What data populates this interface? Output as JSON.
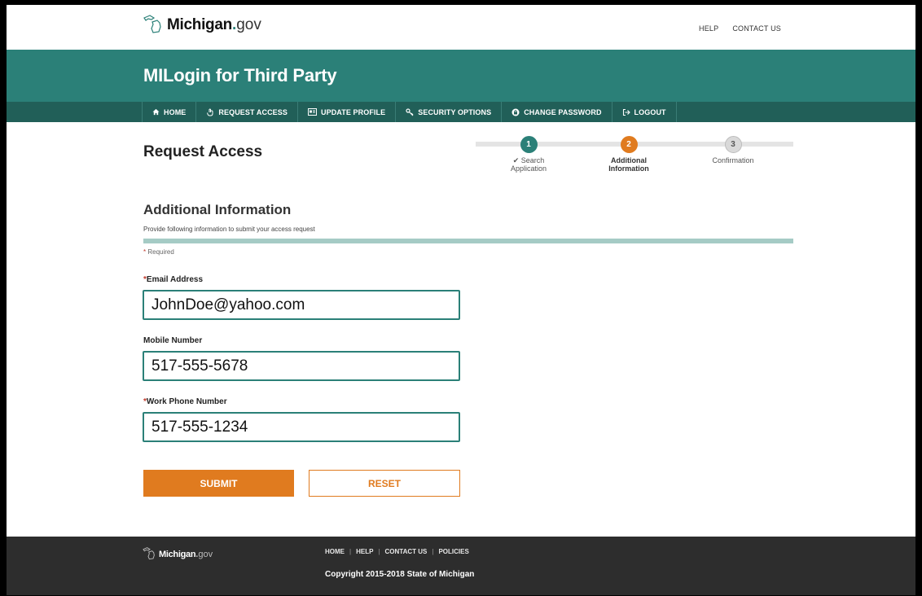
{
  "header": {
    "logo": {
      "name": "Michigan",
      "dot": ".",
      "suffix": "gov"
    },
    "links": [
      "HELP",
      "CONTACT US"
    ]
  },
  "app_title": "MILogin for Third Party",
  "nav": [
    {
      "label": "HOME",
      "icon": "home-icon"
    },
    {
      "label": "REQUEST ACCESS",
      "icon": "hand-pointer-icon"
    },
    {
      "label": "UPDATE PROFILE",
      "icon": "id-card-icon"
    },
    {
      "label": "SECURITY OPTIONS",
      "icon": "key-icon"
    },
    {
      "label": "CHANGE PASSWORD",
      "icon": "lock-circle-icon"
    },
    {
      "label": "LOGOUT",
      "icon": "sign-out-icon"
    }
  ],
  "page": {
    "title": "Request Access",
    "steps": [
      {
        "number": "1",
        "label_line1": "Search",
        "label_line2": "Application",
        "status": "complete",
        "color": "#2b8078"
      },
      {
        "number": "2",
        "label_line1": "Additional",
        "label_line2": "Information",
        "status": "current",
        "color": "#e07b1f"
      },
      {
        "number": "3",
        "label_line1": "Confirmation",
        "label_line2": "",
        "status": "pending",
        "color": "#d9d9d9"
      }
    ],
    "section_title": "Additional Information",
    "section_desc": "Provide following information to submit your access request",
    "required_note": "Required",
    "fields": [
      {
        "label": "Email Address",
        "required": true,
        "value": "JohnDoe@yahoo.com"
      },
      {
        "label": "Mobile Number",
        "required": false,
        "value": "517-555-5678"
      },
      {
        "label": "Work Phone Number",
        "required": true,
        "value": "517-555-1234"
      }
    ],
    "buttons": {
      "submit": "SUBMIT",
      "reset": "RESET"
    }
  },
  "footer": {
    "logo": {
      "name": "Michigan",
      "dot": ".",
      "suffix": "gov"
    },
    "links": [
      "HOME",
      "HELP",
      "CONTACT US",
      "POLICIES"
    ],
    "separator": "|",
    "copyright": "Copyright 2015-2018 State of Michigan"
  },
  "colors": {
    "brand_teal": "#2b8078",
    "nav_dark_teal": "#215f58",
    "accent_orange": "#e07b1f",
    "footer_bg": "#2d2d2d"
  }
}
